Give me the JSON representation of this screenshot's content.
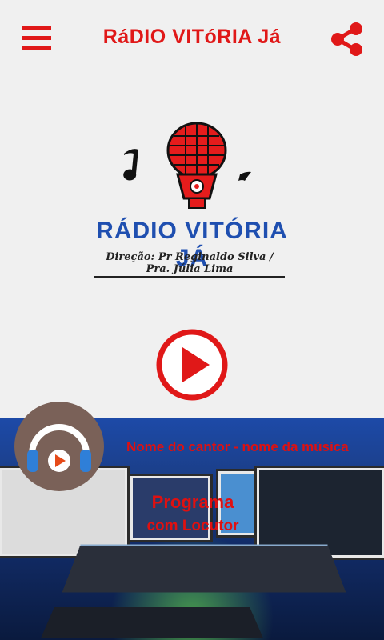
{
  "header": {
    "title": "RáDIO VITóRIA Já",
    "menu_icon": "hamburger-menu-icon",
    "share_icon": "share-icon"
  },
  "logo": {
    "name": "RÁDIO VITÓRIA JÁ",
    "subtitle": "Direção: Pr Reginaldo Silva / Pra. Júlia Lima"
  },
  "player": {
    "play_icon": "play-icon",
    "now_playing": "Nome do cantor - nome da música",
    "program_line1": "Programa",
    "program_line2": "com Locutor"
  },
  "colors": {
    "accent": "#e01818",
    "logo_blue": "#1f4fb0",
    "background": "#f0f0f0"
  }
}
